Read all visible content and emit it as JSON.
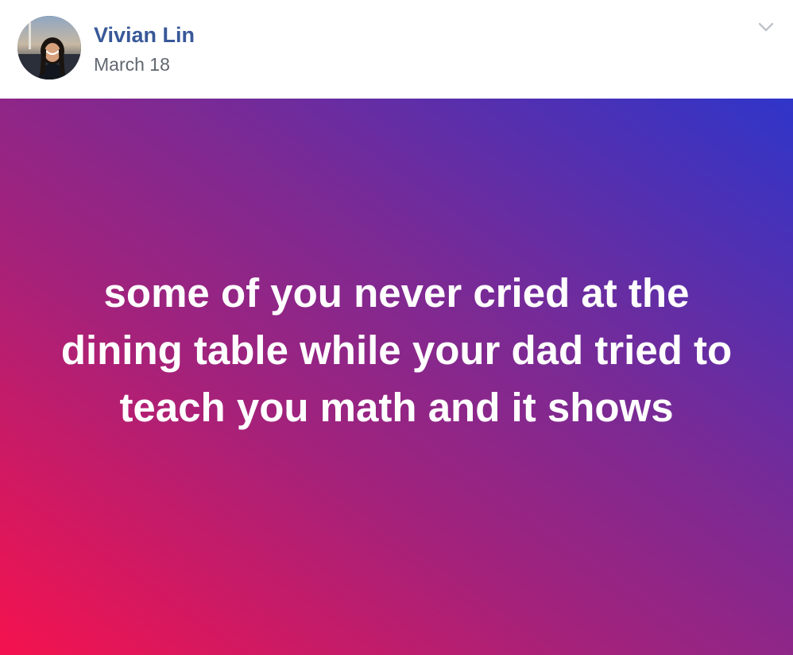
{
  "post": {
    "author": {
      "name": "Vivian Lin",
      "avatar_icon": "profile-photo"
    },
    "date": "March 18",
    "options_icon": "chevron-down-icon",
    "status": {
      "text": "some of you never cried at the dining table while your dad tried to teach you math and it shows",
      "background_colors": [
        "#f5124e",
        "#a3227b",
        "#7a2a95",
        "#2f35c9"
      ],
      "text_color": "#ffffff"
    }
  },
  "colors": {
    "author_link": "#385898",
    "meta_text": "#616770",
    "chevron": "#bec3c9"
  }
}
